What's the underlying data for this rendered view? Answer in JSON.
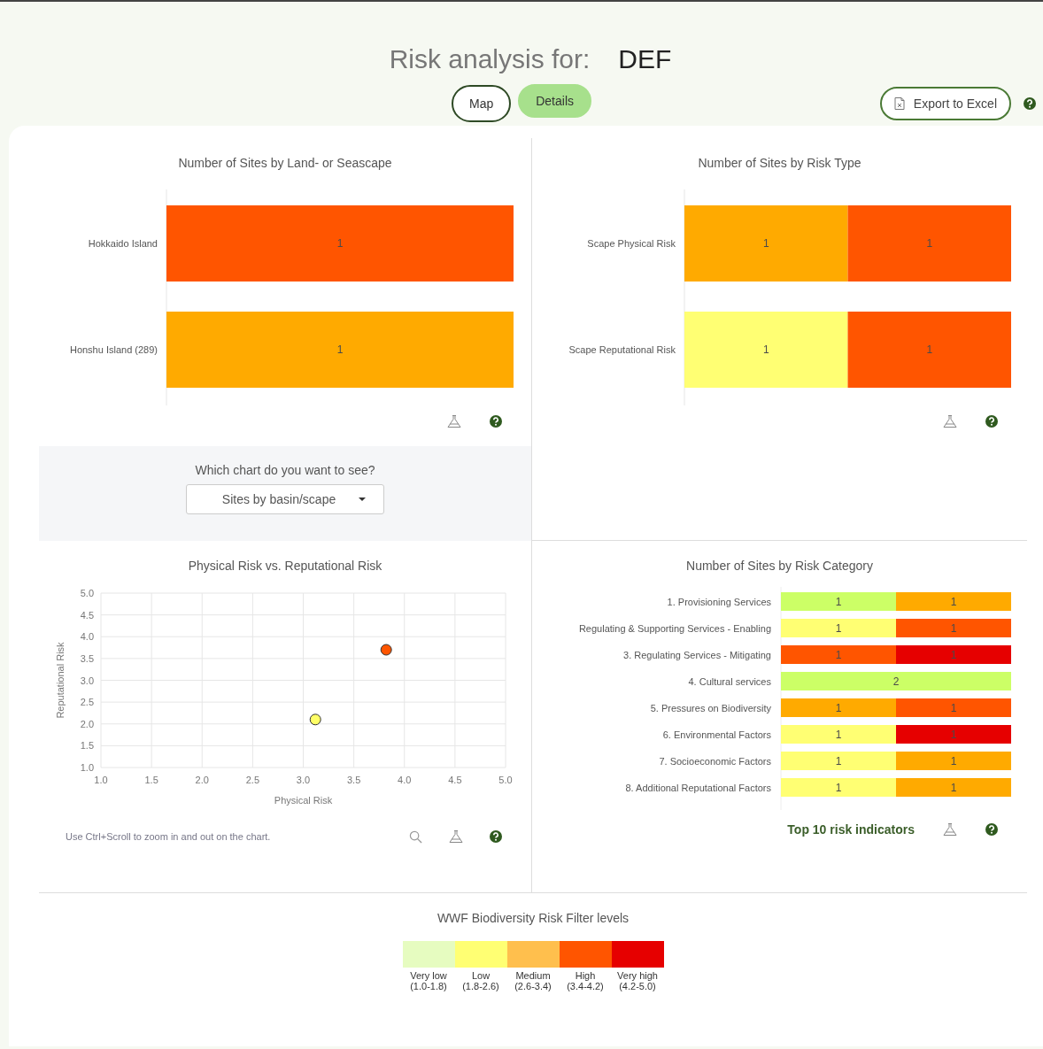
{
  "header": {
    "title": "Risk analysis for:",
    "subject": "DEF"
  },
  "tabs": [
    {
      "label": "Map",
      "selected": false
    },
    {
      "label": "Details",
      "selected": true
    }
  ],
  "export_button": {
    "label": "Export to Excel"
  },
  "land_chart": {
    "chart_data": {
      "type": "bar",
      "title": "Number of Sites by Land- or Seascape",
      "orientation": "horizontal",
      "stacked": true,
      "data_labels": true,
      "categories": [
        "Hokkaido Island",
        "Honshu Island (289)"
      ],
      "series": [
        {
          "color": "#ffaa00",
          "values": [
            null,
            1
          ]
        },
        {
          "color": "#ff5500",
          "values": [
            1,
            null
          ]
        }
      ]
    }
  },
  "risk_type_chart": {
    "chart_data": {
      "type": "bar",
      "title": "Number of Sites by Risk Type",
      "orientation": "horizontal",
      "stacked": true,
      "data_labels": true,
      "categories": [
        "Scape Physical Risk",
        "Scape Reputational Risk"
      ],
      "series": [
        {
          "color": "#ffff73",
          "values": [
            null,
            1
          ]
        },
        {
          "color": "#ffaa00",
          "values": [
            1,
            null
          ]
        },
        {
          "color": "#ff5500",
          "values": [
            1,
            1
          ]
        }
      ]
    }
  },
  "selector": {
    "question": "Which chart do you want to see?",
    "value": "Sites by basin/scape"
  },
  "scatter_chart": {
    "hint": "Use Ctrl+Scroll to zoom in and out on the chart.",
    "chart_data": {
      "type": "scatter",
      "grid": true,
      "title": "Physical Risk vs. Reputational Risk",
      "xlabel": "Physical Risk",
      "ylabel": "Reputational Risk",
      "x": [
        3.12,
        3.82
      ],
      "xlim": [
        1,
        5
      ],
      "ylim": [
        1,
        5
      ],
      "xticks": [
        {
          "value": 1,
          "label": "1.0"
        },
        {
          "value": 1.5,
          "label": "1.5"
        },
        {
          "value": 2,
          "label": "2.0"
        },
        {
          "value": 2.5,
          "label": "2.5"
        },
        {
          "value": 3,
          "label": "3.0"
        },
        {
          "value": 3.5,
          "label": "3.5"
        },
        {
          "value": 4,
          "label": "4.0"
        },
        {
          "value": 4.5,
          "label": "4.5"
        },
        {
          "value": 5,
          "label": "5.0"
        }
      ],
      "yticks": [
        {
          "value": 1,
          "label": "1.0"
        },
        {
          "value": 1.5,
          "label": "1.5"
        },
        {
          "value": 2,
          "label": "2.0"
        },
        {
          "value": 2.5,
          "label": "2.5"
        },
        {
          "value": 3,
          "label": "3.0"
        },
        {
          "value": 3.5,
          "label": "3.5"
        },
        {
          "value": 4,
          "label": "4.0"
        },
        {
          "value": 4.5,
          "label": "4.5"
        },
        {
          "value": 5,
          "label": "5.0"
        }
      ],
      "series": [
        {
          "color": "#ffff66",
          "values": [
            2.1,
            null
          ]
        },
        {
          "color": "#ff5500",
          "values": [
            null,
            3.7
          ]
        }
      ]
    }
  },
  "category_chart": {
    "link": "Top 10 risk indicators",
    "chart_data": {
      "type": "bar",
      "title": "Number of Sites by Risk Category",
      "orientation": "horizontal",
      "stacked": true,
      "data_labels": true,
      "categories": [
        "1. Provisioning Services",
        "Regulating & Supporting Services - Enabling",
        "3. Regulating Services - Mitigating",
        "4. Cultural services",
        "5. Pressures on Biodiversity",
        "6. Environmental Factors",
        "7. Socioeconomic Factors",
        "8. Additional Reputational Factors"
      ],
      "series": [
        {
          "color": "#ccff66",
          "values": [
            1,
            null,
            null,
            2,
            null,
            null,
            null,
            null
          ]
        },
        {
          "color": "#ffff73",
          "values": [
            null,
            1,
            null,
            null,
            null,
            1,
            1,
            1
          ]
        },
        {
          "color": "#ffaa00",
          "values": [
            1,
            null,
            null,
            null,
            1,
            null,
            1,
            1
          ]
        },
        {
          "color": "#ff5500",
          "values": [
            null,
            1,
            1,
            null,
            1,
            null,
            null,
            null
          ]
        },
        {
          "color": "#e60000",
          "values": [
            null,
            null,
            1,
            null,
            null,
            1,
            null,
            null
          ]
        }
      ]
    }
  },
  "legend": {
    "title": "WWF Biodiversity Risk Filter levels",
    "levels": [
      {
        "label": "Very low",
        "range": "(1.0-1.8)",
        "color": "#e6fcc0"
      },
      {
        "label": "Low",
        "range": "(1.8-2.6)",
        "color": "#ffff73"
      },
      {
        "label": "Medium",
        "range": "(2.6-3.4)",
        "color": "#ffbf4d"
      },
      {
        "label": "High",
        "range": "(3.4-4.2)",
        "color": "#ff5500"
      },
      {
        "label": "Very high",
        "range": "(4.2-5.0)",
        "color": "#e60000"
      }
    ]
  }
}
